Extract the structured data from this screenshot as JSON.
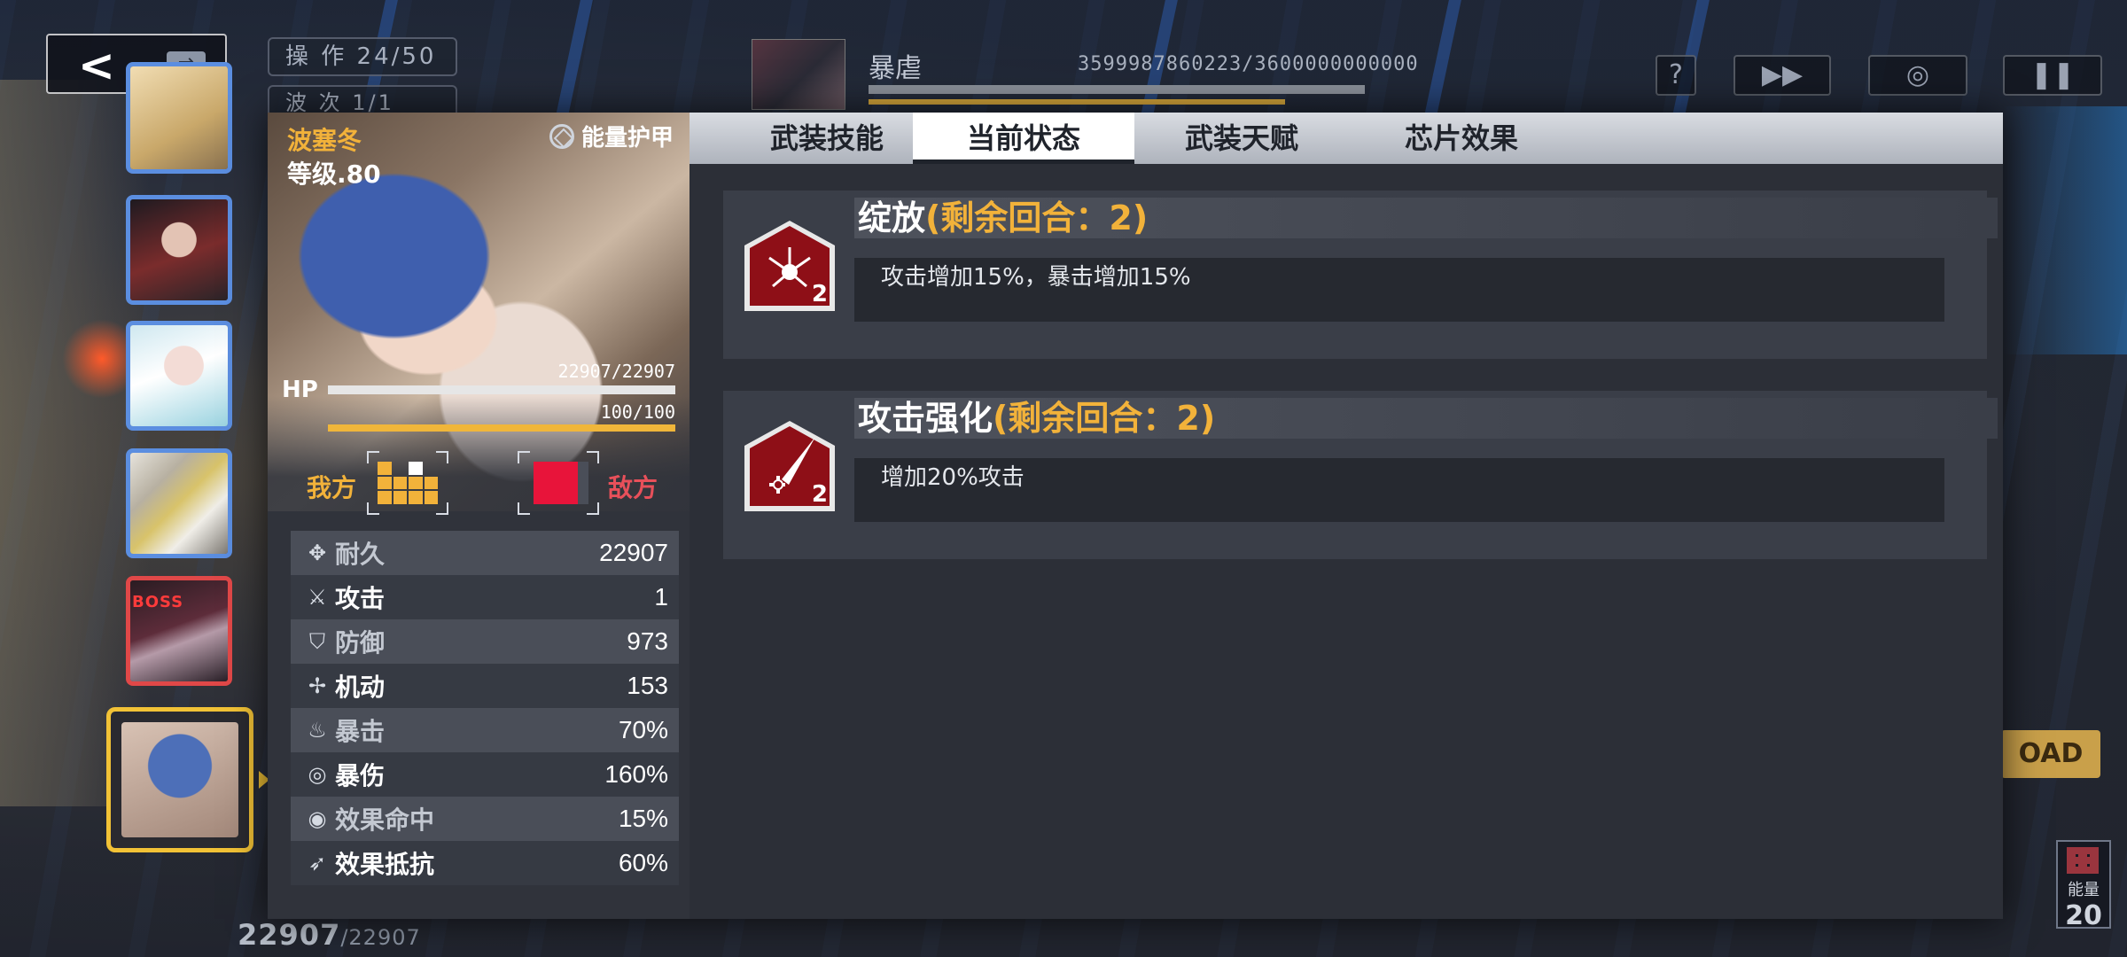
{
  "hud": {
    "back_icon": "back-arrow-icon",
    "ops_label": "操 作 24/50",
    "wave_label": "波 次 1/1",
    "boss_name": "暴虐",
    "boss_hp": "3599987860223/3600000000000",
    "help_label": "?",
    "speed_icon": "fast-forward-icon",
    "auto_icon": "target-icon",
    "pause_icon": "pause-icon"
  },
  "roster": {
    "boss_tag": "BOSS"
  },
  "character": {
    "name": "波塞冬",
    "level": "等级.80",
    "armor_label": "能量护甲",
    "hp_label": "HP",
    "hp_value": "22907/22907",
    "hp_fraction": 1.0,
    "energy_value": "100/100",
    "energy_fraction": 1.0,
    "ally_label": "我方",
    "enemy_label": "敌方"
  },
  "stats": [
    {
      "icon": "durability-icon",
      "glyph": "✥",
      "label": "耐久",
      "value": "22907"
    },
    {
      "icon": "attack-icon",
      "glyph": "⚔",
      "label": "攻击",
      "value": "1"
    },
    {
      "icon": "shield-icon",
      "glyph": "⛉",
      "label": "防御",
      "value": "973"
    },
    {
      "icon": "mobility-icon",
      "glyph": "✢",
      "label": "机动",
      "value": "153"
    },
    {
      "icon": "crit-icon",
      "glyph": "♨",
      "label": "暴击",
      "value": "70%"
    },
    {
      "icon": "crit-damage-icon",
      "glyph": "◎",
      "label": "暴伤",
      "value": "160%"
    },
    {
      "icon": "effect-hit-icon",
      "glyph": "◉",
      "label": "效果命中",
      "value": "15%"
    },
    {
      "icon": "effect-resist-icon",
      "glyph": "➶",
      "label": "效果抵抗",
      "value": "60%"
    }
  ],
  "tabs": [
    {
      "label": "武装技能",
      "active": false
    },
    {
      "label": "当前状态",
      "active": true
    },
    {
      "label": "武装天赋",
      "active": false
    },
    {
      "label": "芯片效果",
      "active": false
    }
  ],
  "effects": [
    {
      "icon": "bloom-flower-icon",
      "stack": "2",
      "name": "绽放",
      "turns": "(剩余回合：2)",
      "desc": "攻击增加15%，暴击增加15%"
    },
    {
      "icon": "attack-boost-blade-icon",
      "stack": "2",
      "name": "攻击强化",
      "turns": "(剩余回合：2)",
      "desc": "增加20%攻击"
    }
  ],
  "bottom": {
    "hp_main": "22907",
    "hp_max": "/22907",
    "load_label": "OAD",
    "energy_label": "能量",
    "energy_value": "20"
  },
  "colors": {
    "accent_gold": "#f2b23a",
    "enemy_red": "#e8143a",
    "ally_border": "#5b8ee0",
    "boss_border": "#e04848"
  }
}
